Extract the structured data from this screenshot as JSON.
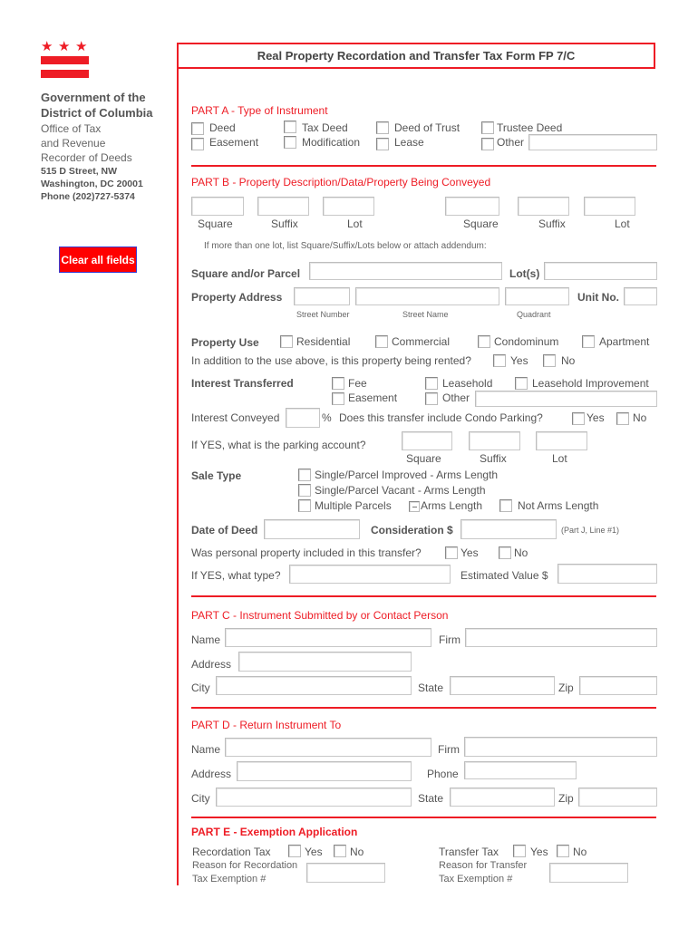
{
  "header": {
    "title": "Real Property Recordation and Transfer Tax Form FP 7/C"
  },
  "logo": {
    "icon": "dc-flag-icon",
    "color": "#ee1c25"
  },
  "sidebar": {
    "org_line1": "Government of the",
    "org_line2": "District of Columbia",
    "office_line1": "Office of Tax",
    "office_line2": "and Revenue",
    "office_line3": "Recorder of Deeds",
    "address_line1": "515 D Street, NW",
    "address_line2": "Washington, DC 20001",
    "phone": "Phone (202)727-5374",
    "clear_button": "Clear all fields"
  },
  "part_a": {
    "title": "PART A - Type of Instrument",
    "options": [
      "Deed",
      "Tax Deed",
      "Deed of Trust",
      "Trustee Deed",
      "Easement",
      "Modification",
      "Lease",
      "Other"
    ],
    "other_value": ""
  },
  "part_b": {
    "title": "PART B - Property Description/Data/Property Being Conveyed",
    "ssl_labels": [
      "Square",
      "Suffix",
      "Lot",
      "Square",
      "Suffix",
      "Lot"
    ],
    "ssl_values": [
      "",
      "",
      "",
      "",
      "",
      ""
    ],
    "more_lots_note": "If more than one lot, list Square/Suffix/Lots below or attach addendum:",
    "square_parcel_label": "Square and/or Parcel",
    "square_parcel_value": "",
    "lots_label": "Lot(s)",
    "lots_value": "",
    "property_address_label": "Property Address",
    "street_number_caption": "Street Number",
    "street_name_caption": "Street Name",
    "quadrant_caption": "Quadrant",
    "unit_label": "Unit No.",
    "street_number_value": "",
    "street_name_value": "",
    "quadrant_value": "",
    "unit_value": "",
    "property_use_label": "Property Use",
    "property_use_options": [
      "Residential",
      "Commercial",
      "Condominum",
      "Apartment"
    ],
    "rented_question": "In addition to the use above, is this property being rented?",
    "yes": "Yes",
    "no": "No",
    "interest_transferred_label": "Interest Transferred",
    "interest_options": [
      "Fee",
      "Leasehold",
      "Leasehold Improvement",
      "Easement",
      "Other"
    ],
    "interest_other_value": "",
    "interest_conveyed_label": "Interest Conveyed",
    "interest_conveyed_value": "",
    "percent_sign": "%",
    "condo_parking_question": "Does this transfer include Condo Parking?",
    "parking_account_question": "If YES, what is the parking account?",
    "parking_labels": [
      "Square",
      "Suffix",
      "Lot"
    ],
    "sale_type_label": "Sale Type",
    "sale_type_options": [
      "Single/Parcel Improved - Arms Length",
      "Single/Parcel Vacant - Arms Length",
      "Multiple Parcels",
      "Arms Length",
      "Not Arms Length"
    ],
    "date_of_deed_label": "Date of Deed",
    "date_of_deed_value": "",
    "consideration_label": "Consideration $",
    "consideration_value": "",
    "consideration_note": "(Part J, Line #1)",
    "personal_property_question": "Was personal property included in this transfer?",
    "personal_type_question": "If YES, what type?",
    "personal_type_value": "",
    "estimated_value_label": "Estimated Value $",
    "estimated_value": ""
  },
  "part_c": {
    "title": "PART C - Instrument Submitted by or Contact Person",
    "name_label": "Name",
    "firm_label": "Firm",
    "address_label": "Address",
    "city_label": "City",
    "state_label": "State",
    "zip_label": "Zip",
    "name": "",
    "firm": "",
    "address": "",
    "city": "",
    "state": "",
    "zip": ""
  },
  "part_d": {
    "title": "PART D - Return Instrument To",
    "name_label": "Name",
    "firm_label": "Firm",
    "address_label": "Address",
    "phone_label": "Phone",
    "city_label": "City",
    "state_label": "State",
    "zip_label": "Zip",
    "name": "",
    "firm": "",
    "address": "",
    "phone": "",
    "city": "",
    "state": "",
    "zip": ""
  },
  "part_e": {
    "title": "PART E - Exemption Application",
    "recordation_label": "Recordation Tax",
    "transfer_label": "Transfer Tax",
    "yes": "Yes",
    "no": "No",
    "recordation_reason_line1": "Reason for Recordation",
    "recordation_reason_line2": "Tax Exemption #",
    "transfer_reason_line1": "Reason for Transfer",
    "transfer_reason_line2": "Tax Exemption #",
    "recordation_reason_value": "",
    "transfer_reason_value": ""
  }
}
